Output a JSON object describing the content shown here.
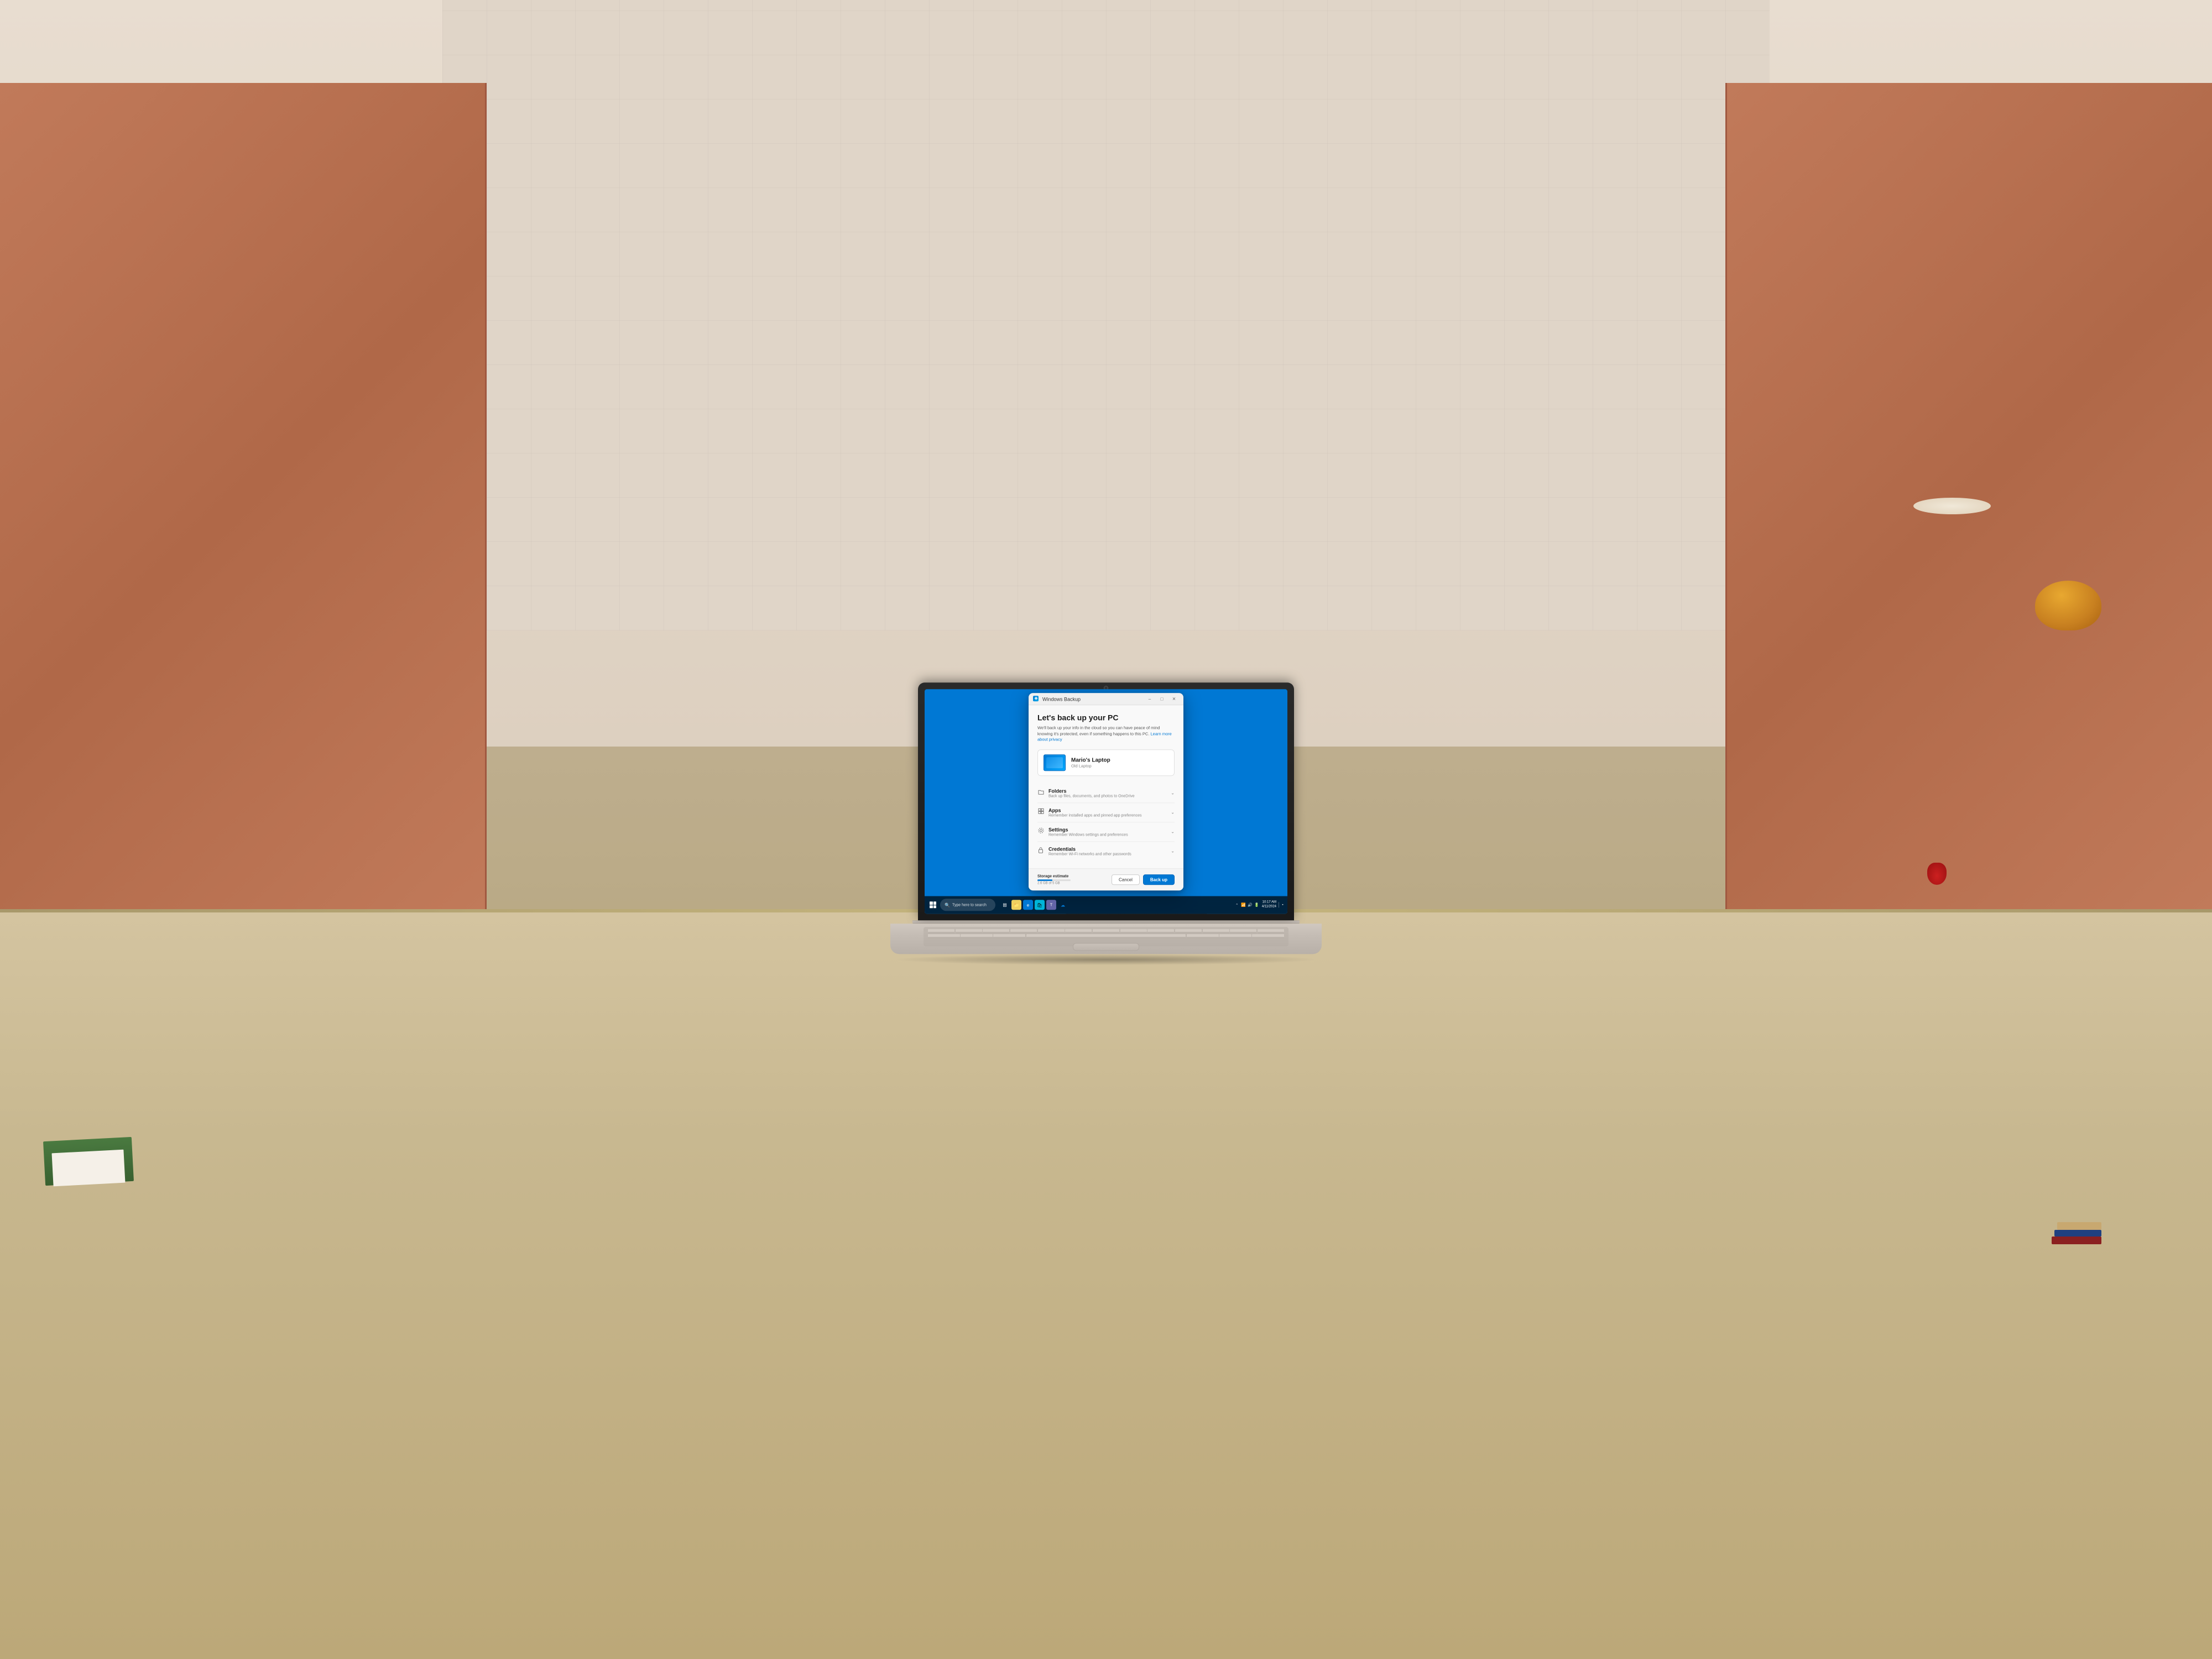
{
  "scene": {
    "background_color": "#8B7355"
  },
  "dialog": {
    "title": "Windows Backup",
    "main_heading": "Let's back up your PC",
    "subtitle": "We'll back up your info in the cloud so you can have peace of mind knowing it's protected, even if something happens to this PC.",
    "subtitle_link_text": "Learn more about privacy",
    "device": {
      "name": "Mario's Laptop",
      "subtitle": "Old Laptop"
    },
    "accordion_items": [
      {
        "icon": "folder",
        "label": "Folders",
        "description": "Back up files, documents, and photos to OneDrive"
      },
      {
        "icon": "apps",
        "label": "Apps",
        "description": "Remember installed apps and pinned app preferences"
      },
      {
        "icon": "settings",
        "label": "Settings",
        "description": "Remember Windows settings and preferences"
      },
      {
        "icon": "credentials",
        "label": "Credentials",
        "description": "Remember Wi-Fi networks and other passwords"
      }
    ],
    "storage": {
      "label": "Storage estimate",
      "value": "2.6 GB of 5 GB"
    },
    "buttons": {
      "cancel": "Cancel",
      "backup": "Back up"
    }
  },
  "taskbar": {
    "search_placeholder": "Type here to search",
    "clock": {
      "time": "10:17 AM",
      "date": "4/11/2024"
    }
  }
}
